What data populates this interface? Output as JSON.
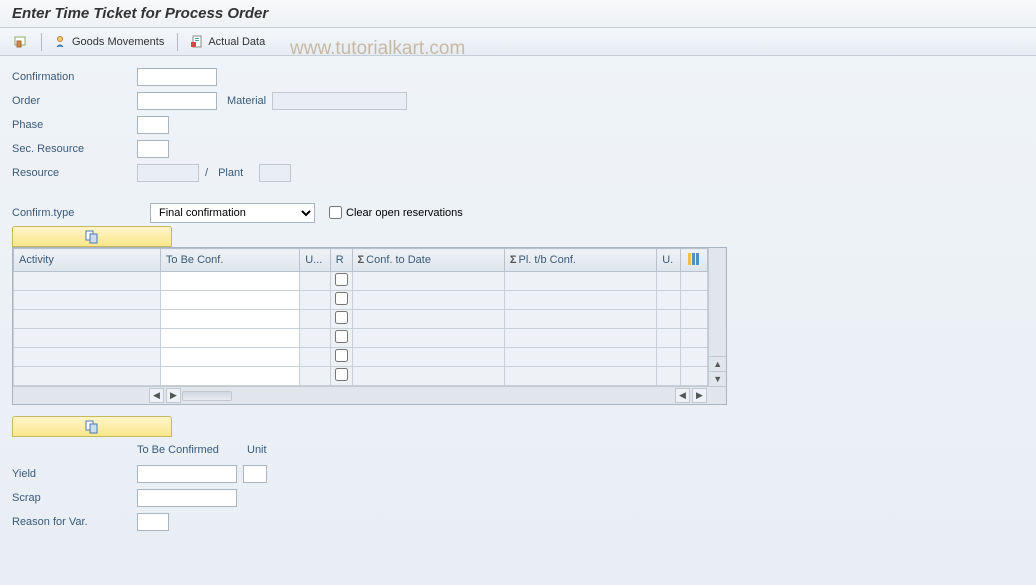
{
  "title": "Enter Time Ticket for Process Order",
  "watermark": "www.tutorialkart.com",
  "toolbar": {
    "goods_movements": "Goods Movements",
    "actual_data": "Actual Data"
  },
  "form": {
    "confirmation_label": "Confirmation",
    "order_label": "Order",
    "material_label": "Material",
    "phase_label": "Phase",
    "sec_resource_label": "Sec. Resource",
    "resource_label": "Resource",
    "slash": "/",
    "plant_label": "Plant",
    "confirm_type_label": "Confirm.type",
    "confirm_type_value": "Final confirmation",
    "clear_open_res_label": "Clear open reservations"
  },
  "table": {
    "columns": {
      "activity": "Activity",
      "to_be_conf": "To Be Conf.",
      "unit_short": "U...",
      "r": "R",
      "conf_to_date": "Conf. to Date",
      "pl_tb_conf": "Pl. t/b Conf.",
      "u2": "U."
    }
  },
  "bottom": {
    "to_be_confirmed": "To Be Confirmed",
    "unit": "Unit",
    "yield": "Yield",
    "scrap": "Scrap",
    "reason_for_var": "Reason for Var."
  }
}
